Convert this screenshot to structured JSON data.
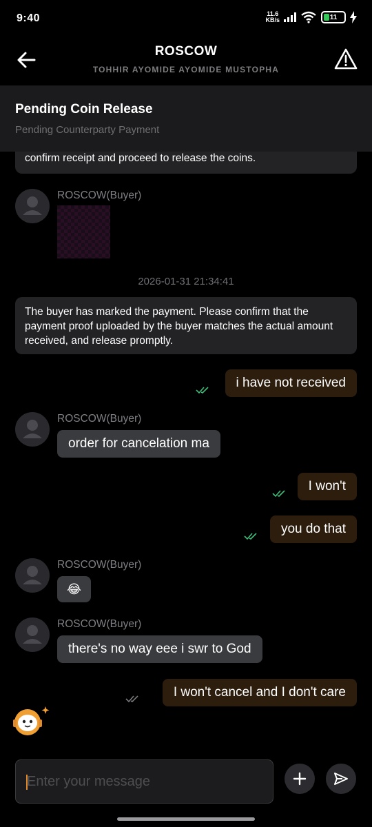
{
  "status_bar": {
    "time": "9:40",
    "net_speed_value": "11.6",
    "net_speed_unit": "KB/s",
    "battery": "11"
  },
  "header": {
    "title": "ROSCOW",
    "subtitle": "TOHHIR AYOMIDE AYOMIDE MUSTOPHA"
  },
  "banner": {
    "title": "Pending Coin Release",
    "subtitle": "Pending Counterparty Payment"
  },
  "messages": {
    "system_top": "confirm receipt and proceed to release the coins.",
    "buyer_label": "ROSCOW(Buyer)",
    "timestamp": "2026-01-31 21:34:41",
    "system_payment": "The buyer has marked the payment. Please confirm that the payment proof uploaded by the buyer matches the actual amount received, and release promptly.",
    "out_1": "i have not received",
    "in_1": "order for cancelation ma",
    "out_2": "I won't",
    "out_3": "you do that",
    "in_2": "😂",
    "in_3": "there's no way eee i swr to God",
    "out_4": "I won't cancel and I don't care"
  },
  "composer": {
    "placeholder": "Enter your message"
  },
  "colors": {
    "accent_tick": "#3dbf7a",
    "outgoing_bubble": "#2c1d0d",
    "incoming_bubble": "#3a3b3f"
  }
}
